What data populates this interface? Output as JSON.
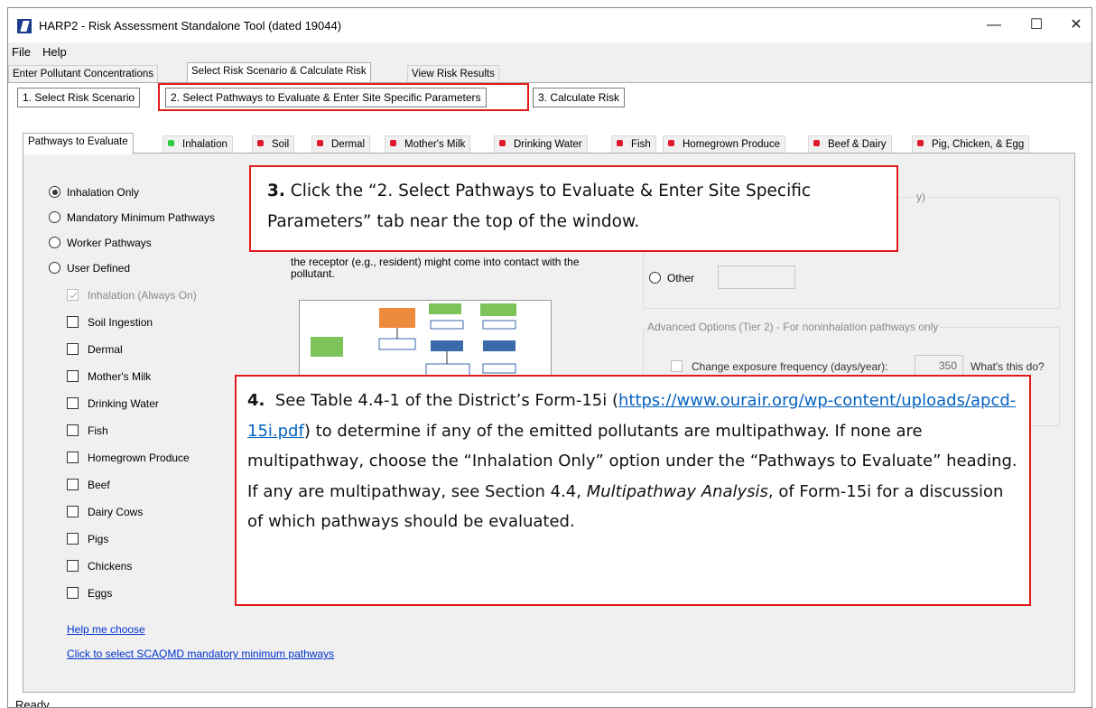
{
  "window": {
    "title": "HARP2 - Risk Assessment Standalone Tool (dated 19044)",
    "minimize": "—",
    "maximize": "☐",
    "close": "✕"
  },
  "menu": {
    "file": "File",
    "help": "Help"
  },
  "main_tabs": [
    "Enter Pollutant Concentrations",
    "Select Risk Scenario & Calculate Risk",
    "View Risk Results"
  ],
  "step_buttons": [
    "1. Select Risk Scenario",
    "2. Select Pathways to Evaluate & Enter Site Specific Parameters",
    "3. Calculate Risk"
  ],
  "pathway_tabs": [
    {
      "label": "Pathways to Evaluate",
      "dot": ""
    },
    {
      "label": "Inhalation",
      "dot": "#2ecc40"
    },
    {
      "label": "Soil",
      "dot": "#e0182b"
    },
    {
      "label": "Dermal",
      "dot": "#e0182b"
    },
    {
      "label": "Mother's Milk",
      "dot": "#e0182b"
    },
    {
      "label": "Drinking Water",
      "dot": "#e0182b"
    },
    {
      "label": "Fish",
      "dot": "#e0182b"
    },
    {
      "label": "Homegrown Produce",
      "dot": "#e0182b"
    },
    {
      "label": "Beef & Dairy",
      "dot": "#e0182b"
    },
    {
      "label": "Pig, Chicken, & Egg",
      "dot": "#e0182b"
    }
  ],
  "pathway_options": [
    "Inhalation Only",
    "Mandatory Minimum Pathways",
    "Worker Pathways",
    "User Defined"
  ],
  "selected_option": "Inhalation Only",
  "checkboxes": [
    {
      "label": "Inhalation (Always On)",
      "checked": true,
      "disabled": true
    },
    {
      "label": "Soil Ingestion"
    },
    {
      "label": "Dermal"
    },
    {
      "label": "Mother's Milk"
    },
    {
      "label": "Drinking Water"
    },
    {
      "label": "Fish"
    },
    {
      "label": "Homegrown Produce"
    },
    {
      "label": "Beef"
    },
    {
      "label": "Dairy Cows"
    },
    {
      "label": "Pigs"
    },
    {
      "label": "Chickens"
    },
    {
      "label": "Eggs"
    }
  ],
  "links": {
    "help": "Help me choose",
    "mandatory": "Click to select SCAQMD mandatory minimum pathways"
  },
  "description": "the receptor (e.g., resident) might come into contact with the pollutant.",
  "group_fragment": "y)",
  "other_option": "Other",
  "advanced": {
    "title": "Advanced Options (Tier 2) - For noninhalation pathways only",
    "checkbox": "Change exposure frequency (days/year):",
    "value": "350",
    "help": "What's this do?"
  },
  "callout3": {
    "number": "3.",
    "text": "Click the “2. Select Pathways to Evaluate & Enter Site Specific Parameters” tab near the top of the window."
  },
  "callout4": {
    "number": "4.",
    "part1": "See Table 4.4-1 of the District’s Form-15i (",
    "url": "https://www.ourair.org/wp-content/uploads/apcd-15i.pdf",
    "part2": ") to determine if any of the emitted pollutants are multipathway.  If none are multipathway, choose the “Inhalation Only” option under the “Pathways to Evaluate” heading.  If any are multipathway, see Section 4.4, ",
    "italic": "Multipathway Analysis",
    "part3": ", of Form-15i for a discussion of which pathways should be evaluated."
  },
  "status": "Ready"
}
